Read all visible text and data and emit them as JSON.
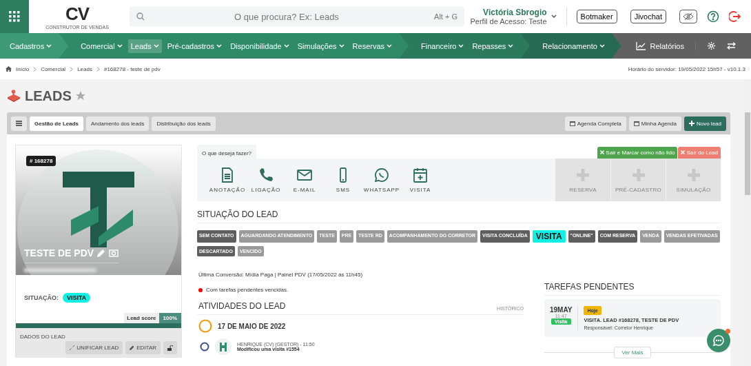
{
  "header": {
    "logo": {
      "text": "CV",
      "tagline": "CONSTRUTOR DE VENDAS"
    },
    "search": {
      "placeholder": "O que procura? Ex: Leads",
      "shortcut": "Alt + G"
    },
    "user": {
      "name": "Victória Sbrogio",
      "profile": "Perfil de Acesso: Teste"
    },
    "buttons": [
      "Botmaker",
      "Jivochat"
    ]
  },
  "nav": {
    "groups": [
      [
        {
          "label": "Cadastros",
          "selected": false
        }
      ],
      [
        {
          "label": "Comercial",
          "selected": false
        },
        {
          "label": "Leads",
          "selected": true
        },
        {
          "label": "Pré-cadastros",
          "selected": false
        },
        {
          "label": "Disponibilidade",
          "selected": false
        },
        {
          "label": "Simulações",
          "selected": false
        },
        {
          "label": "Reservas",
          "selected": false
        }
      ],
      [
        {
          "label": "Financeiro",
          "selected": false
        },
        {
          "label": "Repasses",
          "selected": false
        }
      ],
      [
        {
          "label": "Relacionamento",
          "selected": false
        }
      ]
    ],
    "reports": "Relatórios"
  },
  "breadcrumb": [
    "Início",
    "Comercial",
    "Leads",
    "#168278 - teste de pdv"
  ],
  "server_time": "Horário do servidor: 19/05/2022 15h57 - v10.1.3",
  "page_title": "LEADS",
  "toolbar": {
    "tabs": [
      {
        "label": "Gestão de Leads",
        "selected": true
      },
      {
        "label": "Andamento dos leads",
        "selected": false
      },
      {
        "label": "Distribuição dos leads",
        "selected": false
      }
    ],
    "actions": [
      {
        "label": "Agenda Completa",
        "kind": "plain"
      },
      {
        "label": "Minha Agenda",
        "kind": "plain"
      },
      {
        "label": "Novo lead",
        "kind": "primary"
      }
    ]
  },
  "lead": {
    "id": "# 168278",
    "name": "TESTE DE PDV",
    "situation_label": "SITUAÇÃO:",
    "situation": "VISITA",
    "score_label": "Lead score",
    "score": "100%",
    "level": 1,
    "data_label": "DADOS DO LEAD",
    "buttons": [
      "UNIFICAR LEAD",
      "EDITAR"
    ]
  },
  "actions": {
    "prompt": "O que deseja fazer?",
    "exit_buttons": [
      {
        "label": "Sair e Marcar como não lido",
        "kind": "green"
      },
      {
        "label": "Sair do Lead",
        "kind": "red"
      }
    ],
    "items": [
      {
        "label": "ANOTAÇÃO",
        "disabled": false
      },
      {
        "label": "LIGAÇÃO",
        "disabled": false
      },
      {
        "label": "E-MAIL",
        "disabled": false
      },
      {
        "label": "SMS",
        "disabled": false
      },
      {
        "label": "WHATSAPP",
        "disabled": false
      },
      {
        "label": "VISITA",
        "disabled": false
      },
      {
        "label": "RESERVA",
        "disabled": true
      },
      {
        "label": "PRÉ-CADASTRO",
        "disabled": true
      },
      {
        "label": "SIMULAÇÃO",
        "disabled": true
      }
    ]
  },
  "situation": {
    "title": "SITUAÇÃO DO LEAD",
    "tags": [
      {
        "label": "SEM CONTATO",
        "kind": "passed"
      },
      {
        "label": "AGUARDANDO ATENDIMENTO",
        "kind": "open"
      },
      {
        "label": "TESTE",
        "kind": "open"
      },
      {
        "label": "PRE",
        "kind": "open"
      },
      {
        "label": "TESTE RD",
        "kind": "open"
      },
      {
        "label": "ACOMPANHAMENTO DO CORRETOR",
        "kind": "open"
      },
      {
        "label": "VISITA CONCLUÍDA",
        "kind": "passed"
      },
      {
        "label": "VISITA",
        "kind": "current"
      },
      {
        "label": "\"ONLINE\"",
        "kind": "passed"
      },
      {
        "label": "COM RESERVA",
        "kind": "passed"
      },
      {
        "label": "VENDA",
        "kind": "open"
      },
      {
        "label": "VENDAS EFETIVADAS",
        "kind": "open"
      },
      {
        "label": "DESCARTADO",
        "kind": "passed"
      },
      {
        "label": "VENCIDO",
        "kind": "open"
      }
    ]
  },
  "last_conversion": "Última Conversão: Mídia Paga | Painel PDV (17/05/2022 às 11h45)",
  "overdue_notice": "Com tarefas pendentes vencidas.",
  "activities": {
    "title": "ATIVIDADES DO LEAD",
    "history_link": "HISTÓRICO",
    "date": "17 DE MAIO DE 2022",
    "entries": [
      {
        "author": "HENRIQUE (CV) (GESTOR) - 11:50",
        "text": "Modificou uma visita #1554"
      }
    ]
  },
  "tasks": {
    "title": "TAREFAS PENDENTES",
    "items": [
      {
        "day": "19MAY",
        "time": "11:47",
        "type": "Visita",
        "badge": "Hoje",
        "title": "VISITA. LEAD #168278, TESTE DE PDV",
        "owner": "Responsável: Corretor Henrique"
      }
    ],
    "more": "Ver Mais"
  }
}
